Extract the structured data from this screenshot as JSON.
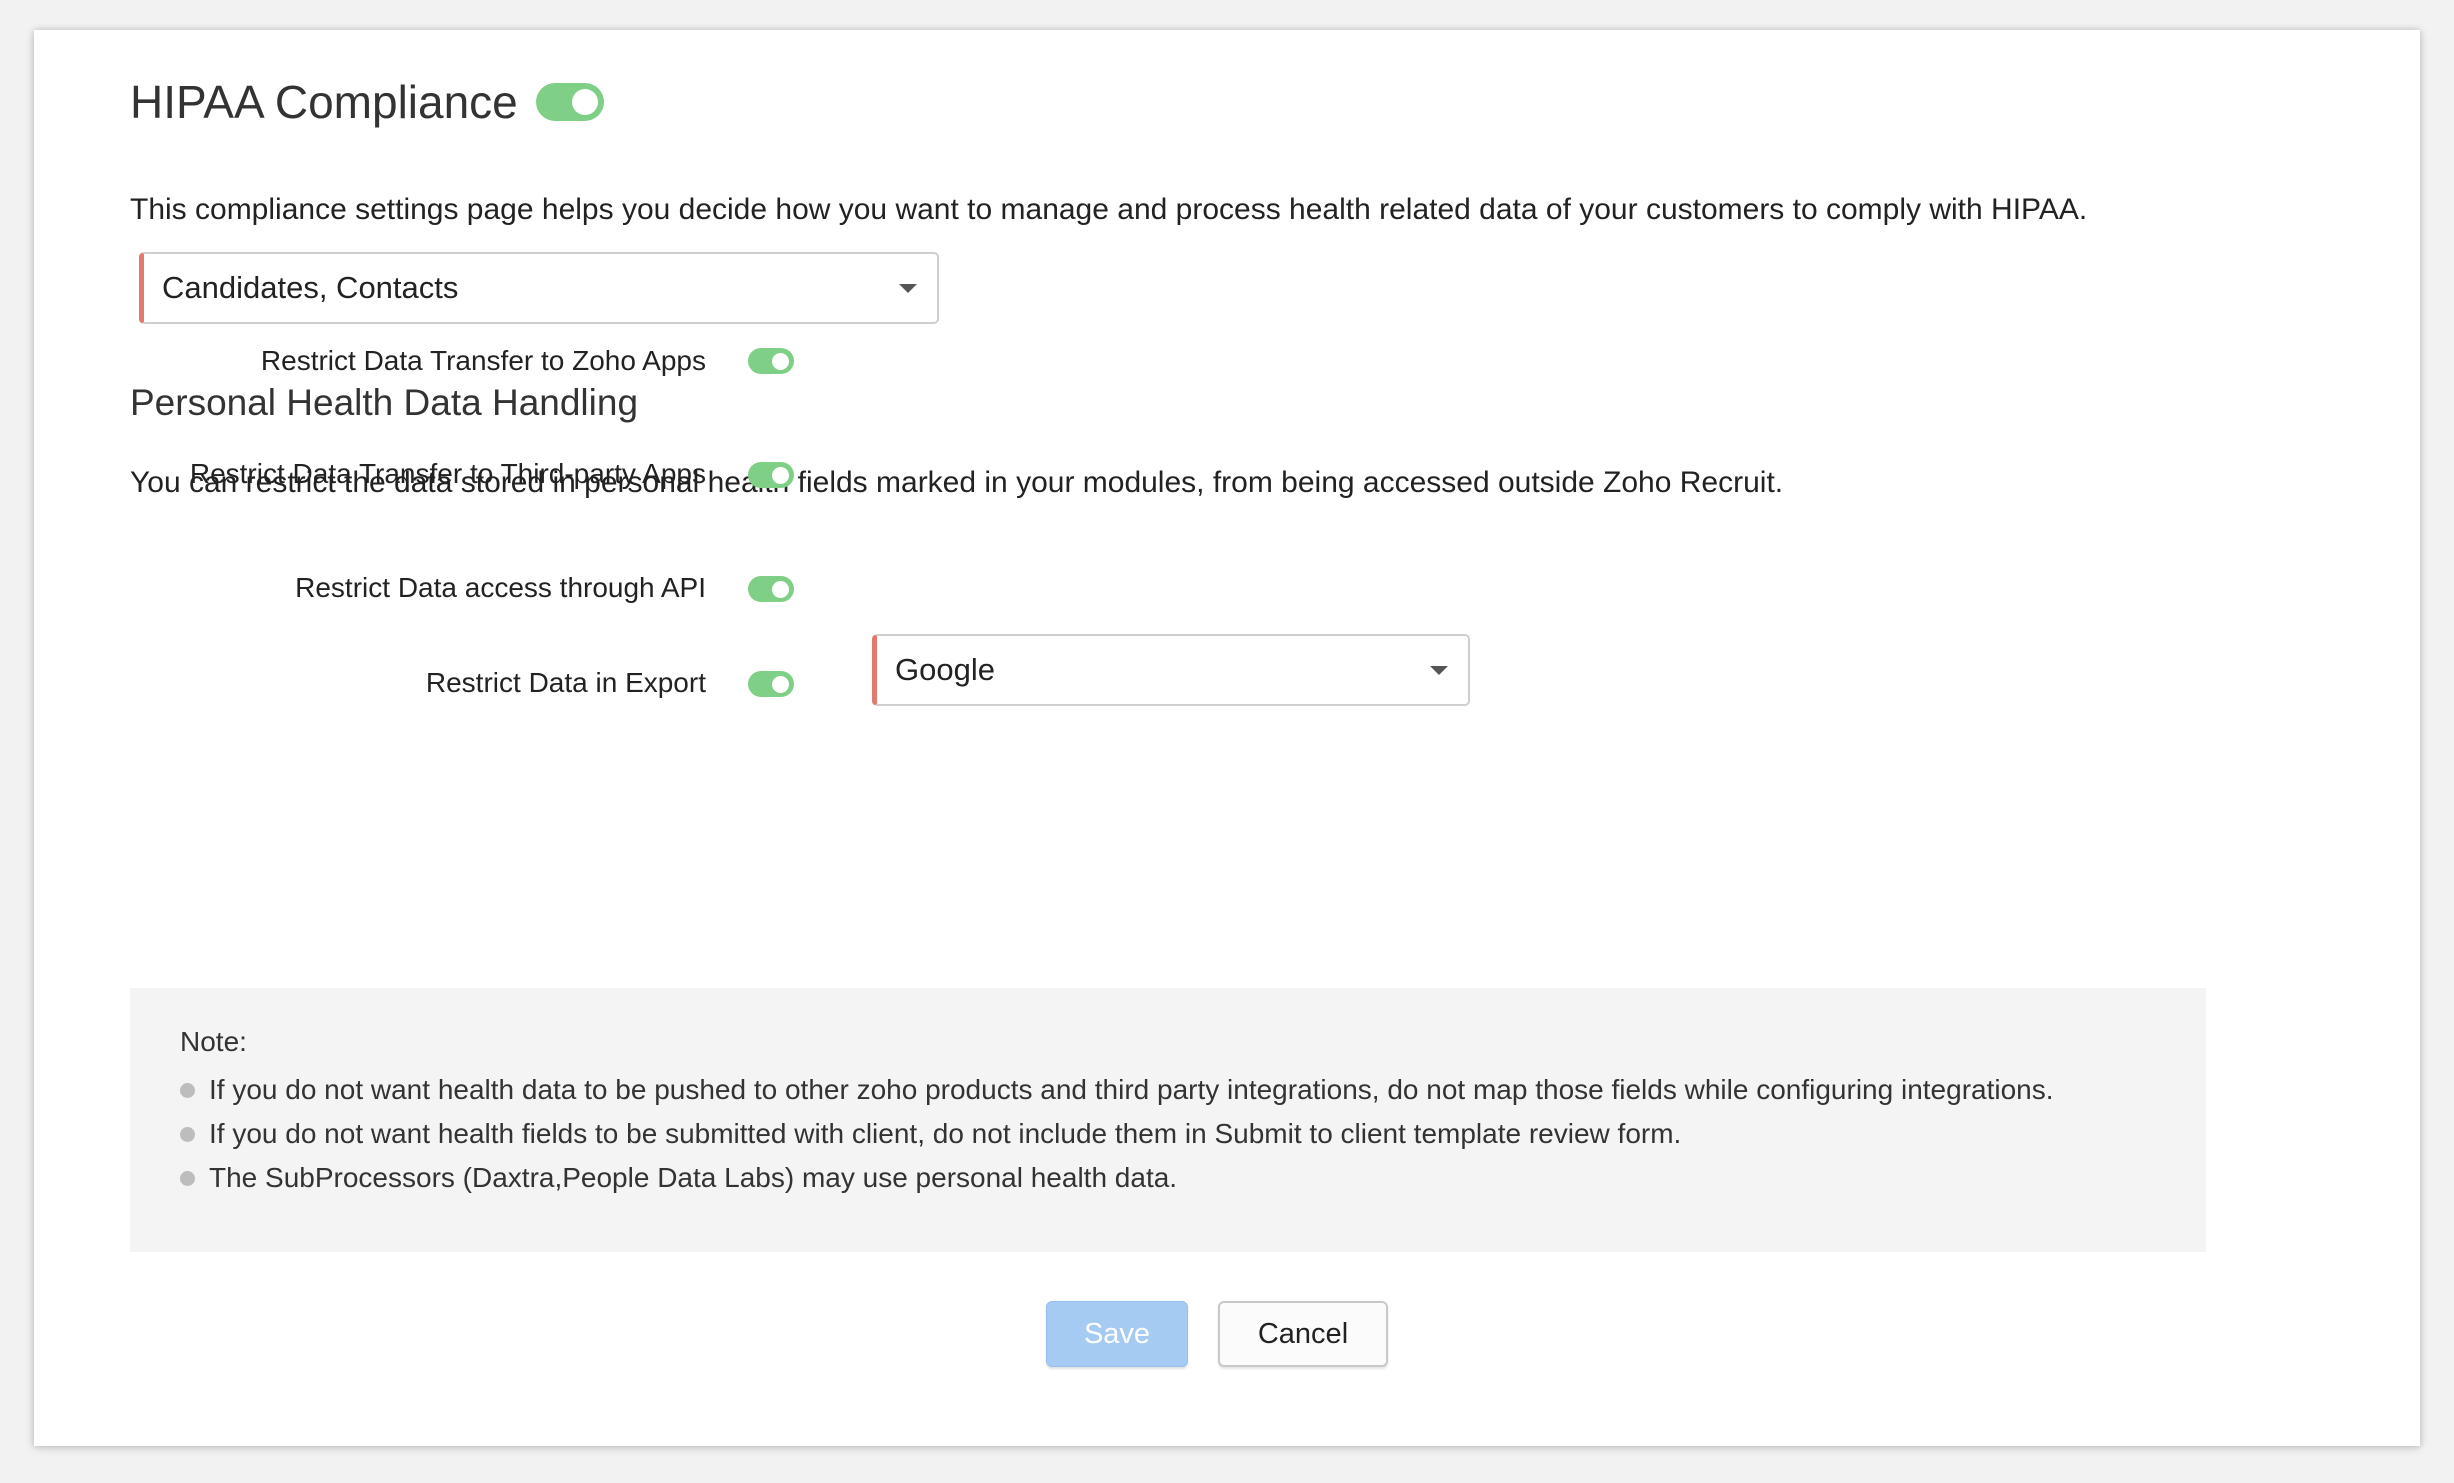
{
  "colors": {
    "toggle_on": "#7fcf86",
    "required_marker": "#e3786f",
    "save_button_disabled": "#a6cbf3",
    "note_background": "#f4f4f4"
  },
  "header": {
    "title": "HIPAA Compliance",
    "enabled": true,
    "description": "This compliance settings page helps you decide how you want to manage and process health related data of your customers to comply with HIPAA."
  },
  "modules_select": {
    "value": "Candidates, Contacts",
    "icon": "chevron-down-icon"
  },
  "health_data": {
    "title": "Personal Health Data Handling",
    "description": "You can restrict the data stored in personal health fields marked in your modules, from being accessed outside Zoho Recruit.",
    "options": [
      {
        "label": "Restrict Data Transfer to Zoho Apps",
        "enabled": true
      },
      {
        "label": "Restrict Data Transfer to Third-party Apps",
        "enabled": true
      },
      {
        "label": "Restrict Data access through API",
        "enabled": true
      },
      {
        "label": "Restrict Data in Export",
        "enabled": true
      }
    ],
    "third_party_select": {
      "value": "Google",
      "icon": "chevron-down-icon"
    }
  },
  "note": {
    "title": "Note:",
    "items": [
      "If you do not want health data to be pushed to other zoho products and third party integrations, do not map those fields while configuring integrations.",
      "If you do not want health fields to be submitted with client, do not include them in Submit to client template review form.",
      "The SubProcessors (Daxtra,People Data Labs) may use personal health data."
    ]
  },
  "actions": {
    "save_label": "Save",
    "cancel_label": "Cancel"
  }
}
